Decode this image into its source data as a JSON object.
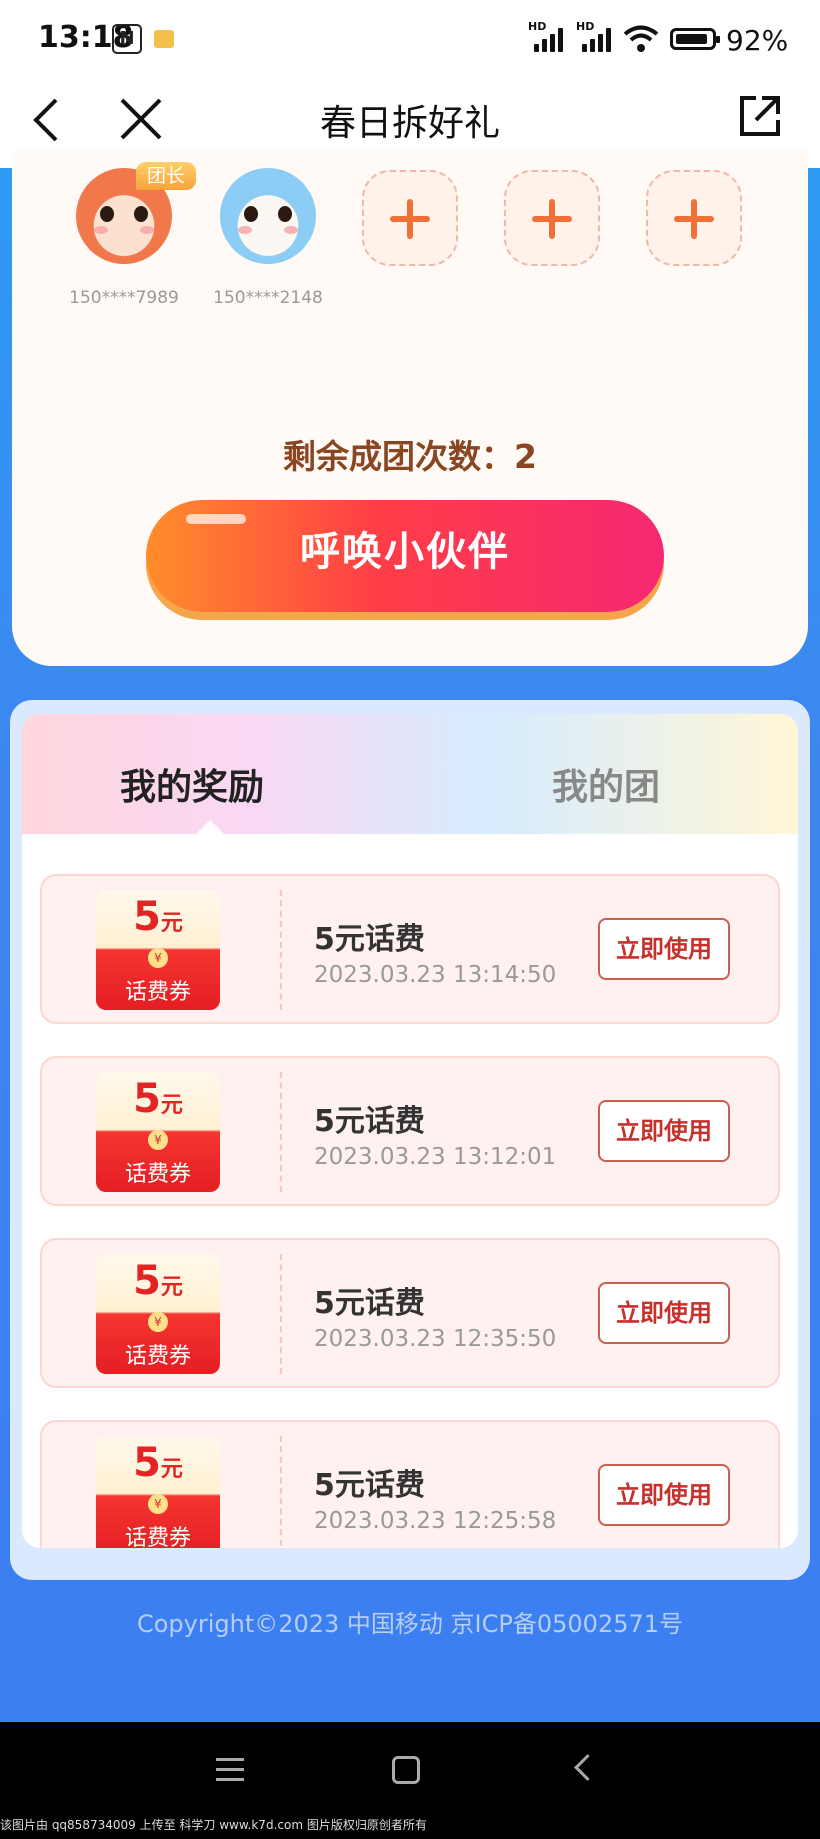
{
  "status": {
    "time": "13:18",
    "nfc": "N",
    "hd1": "HD",
    "hd2": "HD",
    "battery": "92%",
    "battery_level": 0.92
  },
  "nav": {
    "title": "春日拆好礼",
    "back_icon": "chevron-left-icon",
    "close_icon": "close-icon",
    "share_icon": "share-icon"
  },
  "team": {
    "leader_badge": "团长",
    "members": [
      {
        "name": "150****7989",
        "avatar": "orange-mascot"
      },
      {
        "name": "150****2148",
        "avatar": "blue-mascot"
      }
    ],
    "empty_slots": 3,
    "remaining": "剩余成团次数：2",
    "summon_button": "呼唤小伙伴"
  },
  "tabs": [
    {
      "label": "我的奖励",
      "active": true
    },
    {
      "label": "我的团",
      "active": false
    }
  ],
  "coupons": [
    {
      "amount": "5",
      "unit": "元",
      "badge": "话费券",
      "coin": "¥",
      "title": "5元话费",
      "time": "2023.03.23 13:14:50",
      "action": "立即使用"
    },
    {
      "amount": "5",
      "unit": "元",
      "badge": "话费券",
      "coin": "¥",
      "title": "5元话费",
      "time": "2023.03.23 13:12:01",
      "action": "立即使用"
    },
    {
      "amount": "5",
      "unit": "元",
      "badge": "话费券",
      "coin": "¥",
      "title": "5元话费",
      "time": "2023.03.23 12:35:50",
      "action": "立即使用"
    },
    {
      "amount": "5",
      "unit": "元",
      "badge": "话费券",
      "coin": "¥",
      "title": "5元话费",
      "time": "2023.03.23 12:25:58",
      "action": "立即使用"
    }
  ],
  "copyright": "Copyright©2023 中国移动 京ICP备05002571号",
  "watermark": "该图片由 qq858734009 上传至 科学刀 www.k7d.com 图片版权归原创者所有",
  "colors": {
    "primary_blue": "#3b86f0",
    "accent_red": "#e32424",
    "button_gradient_start": "#ff8d2a",
    "button_gradient_end": "#f52872"
  }
}
